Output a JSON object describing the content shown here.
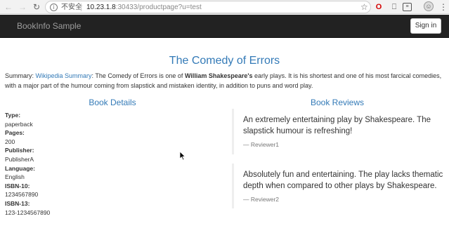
{
  "browser": {
    "info_icon": "i",
    "insecure_label": "不安全",
    "url_host": "10.23.1.8",
    "url_rest": ":30433/productpage?u=test",
    "icons": [
      "back-arrow-icon",
      "forward-arrow-icon",
      "reload-icon",
      "info-icon",
      "star-icon",
      "opera-icon",
      "bookmark-icon",
      "reader-icon",
      "avatar-icon",
      "menu-icon"
    ]
  },
  "navbar": {
    "brand": "BookInfo Sample",
    "signin_label": "Sign in"
  },
  "product": {
    "title": "The Comedy of Errors",
    "summary_prefix": "Summary: ",
    "summary_link": "Wikipedia Summary",
    "summary_mid": ": The Comedy of Errors is one of ",
    "summary_bold": "William Shakespeare's",
    "summary_rest": " early plays. It is his shortest and one of his most farcical comedies, with a major part of the humour coming from slapstick and mistaken identity, in addition to puns and word play."
  },
  "details": {
    "heading": "Book Details",
    "type_label": "Type:",
    "type_value": "paperback",
    "pages_label": "Pages:",
    "pages_value": "200",
    "publisher_label": "Publisher:",
    "publisher_value": "PublisherA",
    "language_label": "Language:",
    "language_value": "English",
    "isbn10_label": "ISBN-10:",
    "isbn10_value": "1234567890",
    "isbn13_label": "ISBN-13:",
    "isbn13_value": "123-1234567890"
  },
  "reviews": {
    "heading": "Book Reviews",
    "items": [
      {
        "text": "An extremely entertaining play by Shakespeare. The slapstick humour is refreshing!",
        "author": "— Reviewer1"
      },
      {
        "text": "Absolutely fun and entertaining. The play lacks thematic depth when compared to other plays by Shakespeare.",
        "author": "— Reviewer2"
      }
    ]
  },
  "colors": {
    "link": "#337ab7",
    "navbar": "#222222",
    "brand": "#9d9d9d"
  }
}
